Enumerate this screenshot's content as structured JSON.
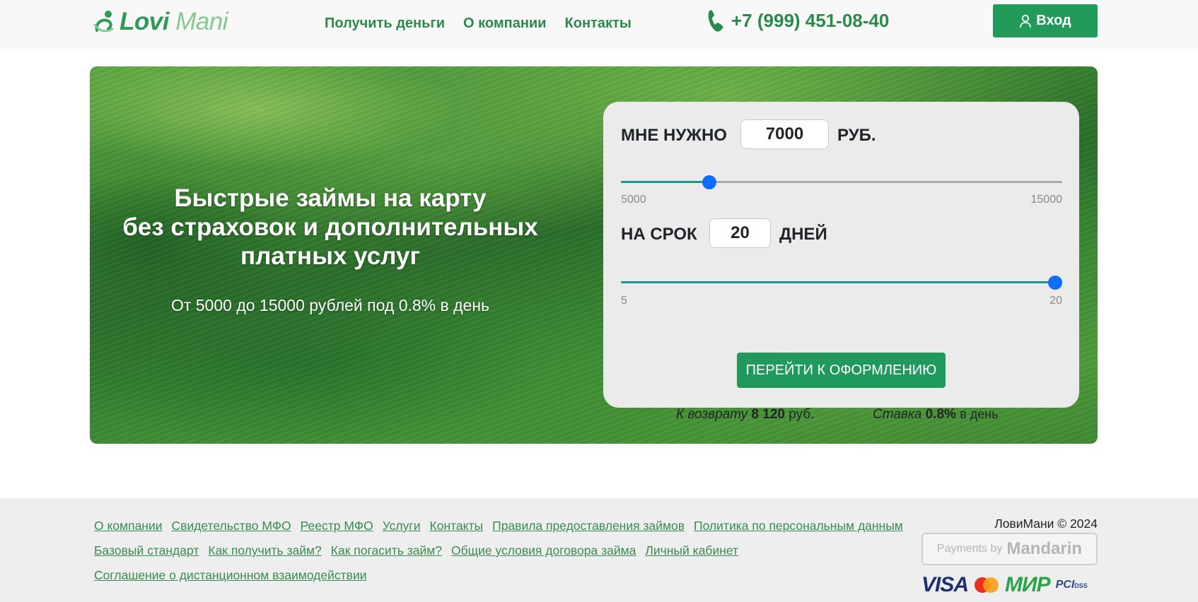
{
  "header": {
    "logo": {
      "word1": "Lovi",
      "word2": "Mani"
    },
    "nav": [
      {
        "label": "Получить деньги"
      },
      {
        "label": "О компании"
      },
      {
        "label": "Контакты"
      }
    ],
    "phone": "+7 (999) 451-08-40",
    "login_label": "Вход"
  },
  "hero": {
    "title_line1": "Быстрые займы на карту",
    "title_line2": "без страховок и дополнительных",
    "title_line3": "платных услуг",
    "subtitle": "От 5000 до 15000 рублей под 0.8% в день"
  },
  "calculator": {
    "amount": {
      "label": "МНЕ НУЖНО",
      "value": "7000",
      "unit": "РУБ.",
      "min": "5000",
      "max": "15000",
      "fraction": 0.2
    },
    "term": {
      "label": "НА СРОК",
      "value": "20",
      "unit": "ДНЕЙ",
      "min": "5",
      "max": "20",
      "fraction": 1.0
    },
    "cta_label": "ПЕРЕЙТИ К ОФОРМЛЕНИЮ",
    "return_label": "К возврату",
    "return_value": "8 120",
    "return_unit": "руб.",
    "rate_label": "Ставка",
    "rate_value": "0.8%",
    "rate_unit": "в день"
  },
  "footer": {
    "links_row1": [
      "О компании",
      "Свидетельство МФО",
      "Реестр МФО",
      "Услуги",
      "Контакты",
      "Правила предоставления займов",
      "Политика по персональным данным"
    ],
    "links_row2": [
      "Базовый стандарт",
      "Как получить займ?",
      "Как погасить займ?",
      "Общие условия договора займа",
      "Личный кабинет"
    ],
    "links_row3": [
      "Соглашение о дистанционном взаимодействии"
    ],
    "copyright": "ЛовиМани © 2024",
    "payments_by": "Payments by",
    "payments_brand": "Mandarin",
    "card_brands": [
      "VISA",
      "МИР",
      "PCI",
      "DSS"
    ]
  },
  "colors": {
    "brand_green": "#219a5a",
    "link_green": "#2b8a4a",
    "slider_thumb": "#0d6efd",
    "slider_fill": "#1a9a8c"
  }
}
